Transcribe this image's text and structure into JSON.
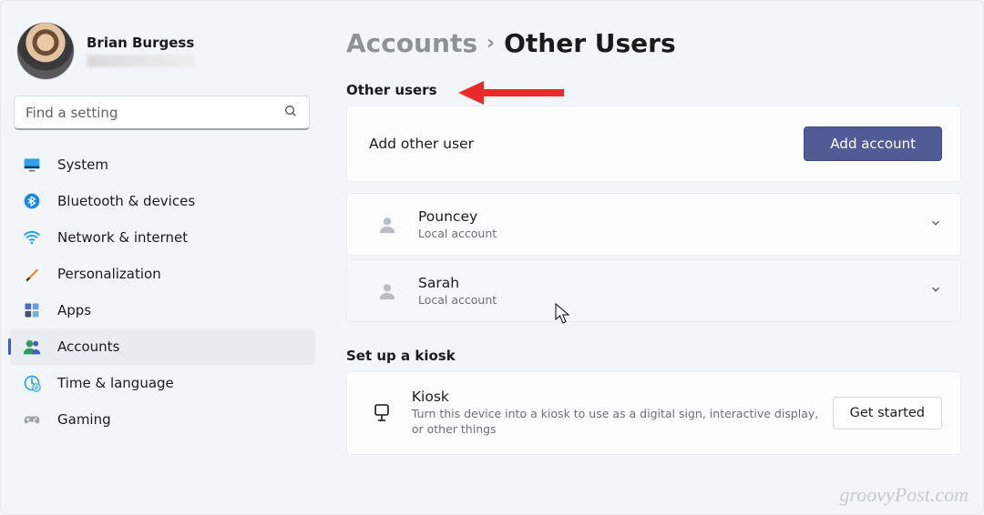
{
  "profile": {
    "name": "Brian Burgess"
  },
  "search": {
    "placeholder": "Find a setting"
  },
  "sidebar": {
    "items": [
      {
        "label": "System",
        "key": "system"
      },
      {
        "label": "Bluetooth & devices",
        "key": "bluetooth"
      },
      {
        "label": "Network & internet",
        "key": "network"
      },
      {
        "label": "Personalization",
        "key": "personalization"
      },
      {
        "label": "Apps",
        "key": "apps"
      },
      {
        "label": "Accounts",
        "key": "accounts"
      },
      {
        "label": "Time & language",
        "key": "time"
      },
      {
        "label": "Gaming",
        "key": "gaming"
      }
    ],
    "selected_index": 5
  },
  "breadcrumb": {
    "parent": "Accounts",
    "current": "Other Users"
  },
  "sections": {
    "other_users_heading": "Other users",
    "add_other_user_label": "Add other user",
    "add_account_button": "Add account",
    "users": [
      {
        "name": "Pouncey",
        "type": "Local account"
      },
      {
        "name": "Sarah",
        "type": "Local account"
      }
    ],
    "kiosk_heading": "Set up a kiosk",
    "kiosk_title": "Kiosk",
    "kiosk_description": "Turn this device into a kiosk to use as a digital sign, interactive display, or other things",
    "kiosk_button": "Get started"
  },
  "watermark": "groovyPost.com"
}
